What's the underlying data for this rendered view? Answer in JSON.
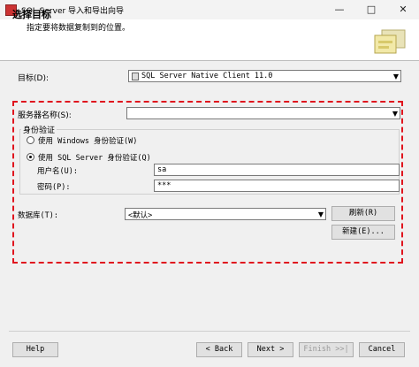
{
  "window": {
    "title": "SQL Server 导入和导出向导",
    "minimize": "—",
    "maximize": "□",
    "close": "✕"
  },
  "header": {
    "title": "选择目标",
    "subtitle": "指定要将数据复制到的位置。"
  },
  "destination": {
    "label": "目标(D):",
    "value": "SQL Server Native Client 11.0"
  },
  "server": {
    "label": "服务器名称(S):",
    "value": ""
  },
  "auth": {
    "group_label": "身份验证",
    "windows_label": "使用 Windows 身份验证(W)",
    "sql_label": "使用 SQL Server 身份验证(Q)",
    "selected": "sql",
    "username_label": "用户名(U):",
    "username_value": "sa",
    "password_label": "密码(P):",
    "password_value": "***"
  },
  "database": {
    "label": "数据库(T):",
    "value": "<默认>",
    "refresh_label": "刷新(R)",
    "new_label": "新建(E)..."
  },
  "footer": {
    "help": "Help",
    "back": "< Back",
    "next": "Next >",
    "finish": "Finish >>|",
    "cancel": "Cancel"
  },
  "colors": {
    "highlight_border": "#e0141e"
  }
}
